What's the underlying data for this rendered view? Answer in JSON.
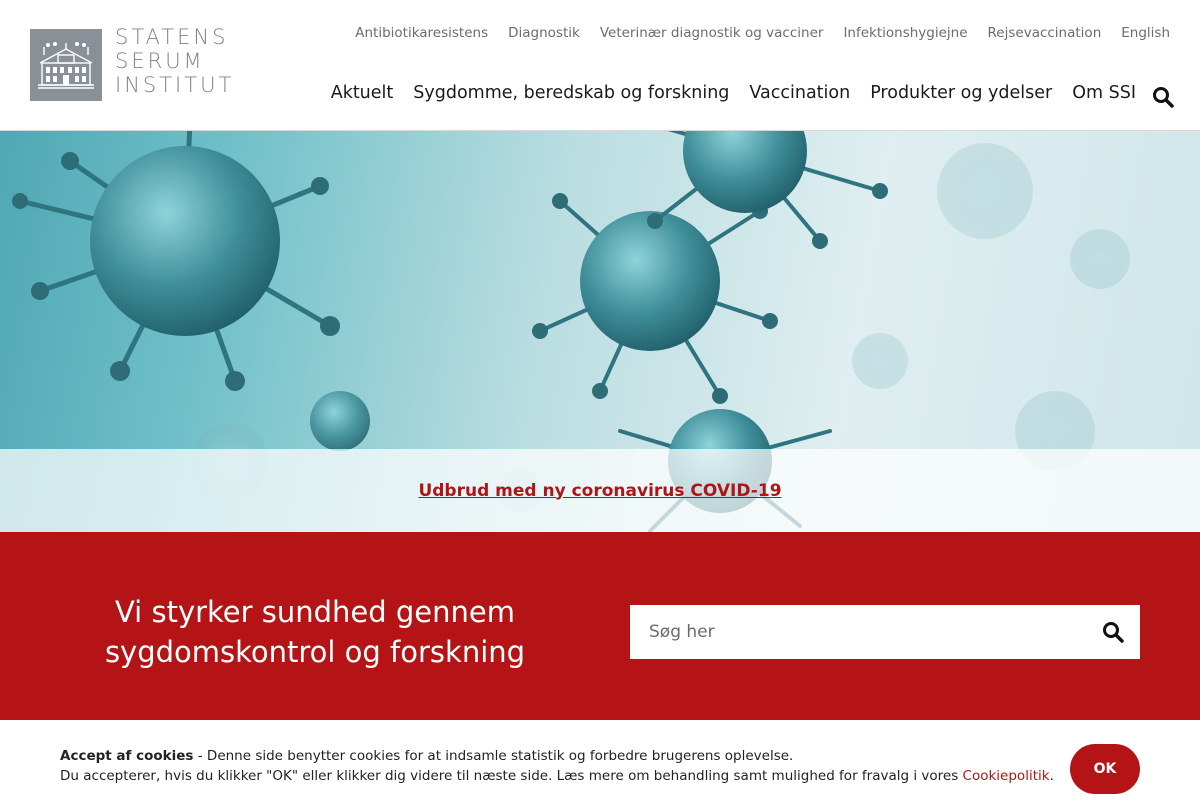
{
  "brand": {
    "name_lines": [
      "STATENS",
      "SERUM",
      "INSTITUT"
    ],
    "mark_color": "#8a9098"
  },
  "utility_nav": [
    "Antibiotikaresistens",
    "Diagnostik",
    "Veterinær diagnostik og vacciner",
    "Infektionshygiejne",
    "Rejsevaccination",
    "English"
  ],
  "main_nav": [
    "Aktuelt",
    "Sygdomme, beredskab og forskning",
    "Vaccination",
    "Produkter og ydelser",
    "Om SSI"
  ],
  "hero": {
    "alert_link": "Udbrud med ny coronavirus COVID-19"
  },
  "mission": {
    "tagline_line1": "Vi styrker sundhed gennem",
    "tagline_line2": "sygdomskontrol og forskning",
    "search_placeholder": "Søg her"
  },
  "cookie": {
    "title": "Accept af cookies",
    "line1_rest": " - Denne side benytter cookies for at indsamle statistik og forbedre brugerens oplevelse.",
    "line2": "Du accepterer, hvis du klikker \"OK\" eller klikker dig videre til næste side. Læs mere om behandling samt mulighed for fravalg i vores ",
    "policy_link": "Cookiepolitik",
    "period": ".",
    "ok_label": "OK"
  },
  "colors": {
    "brand_red": "#b41415",
    "link_red": "#b01515",
    "nav_gray": "#6c6c6c"
  },
  "icons": {
    "search": "search-icon",
    "logo": "building-logo-icon"
  }
}
